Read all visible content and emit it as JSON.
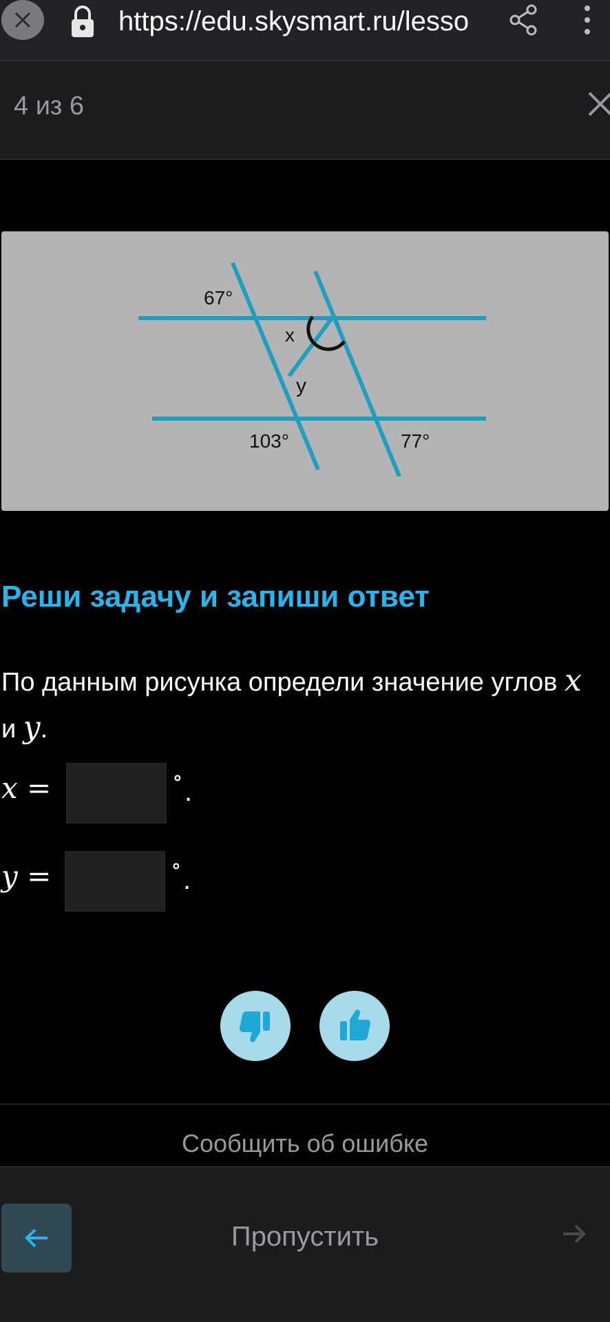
{
  "browser": {
    "url": "https://edu.skysmart.ru/lesso"
  },
  "progress": {
    "text": "4 из 6"
  },
  "figure": {
    "labels": {
      "angle_67": "67°",
      "angle_x": "x",
      "angle_y": "y",
      "angle_103": "103°",
      "angle_77": "77°"
    },
    "line_color": "#1f9ec0",
    "background": "#b4b4b4"
  },
  "task": {
    "title": "Реши задачу и запиши ответ",
    "text_part1": "По данным рисунка определи значение углов",
    "var_x": "x",
    "conjunction": "и",
    "var_y": "y",
    "end": "."
  },
  "answers": {
    "x_label": "x =",
    "y_label": "y =",
    "x_value": "",
    "y_value": "",
    "degree": "∘",
    "period": "."
  },
  "footer": {
    "report": "Сообщить об ошибке",
    "skip": "Пропустить"
  },
  "colors": {
    "accent": "#27b5ef",
    "rate_button": "#a7dbe9"
  }
}
